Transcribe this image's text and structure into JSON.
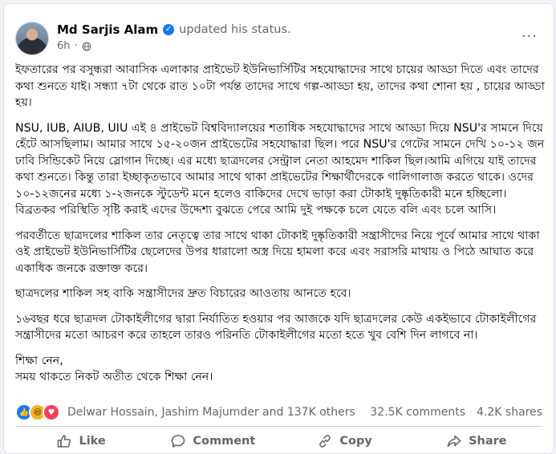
{
  "post": {
    "author": "Md Sarjis Alam",
    "action": "updated his status.",
    "time": "6h",
    "more": "···",
    "paragraphs": [
      "ইফতারের পর বসুন্ধরা আবাসিক এলাকার প্রাইভেট ইউনিভার্সিটির সহযোদ্ধাদের সাথে চায়ের আড্ডা দিতে এবং তাদের কথা শুনতে যাই। সন্ধ্যা ৭টা থেকে রাত ১০টা পর্যন্ত তাদের সাথে গল্প-আড্ডা হয়, তাদের কথা শোনা হয় , চায়ের আড্ডা হয়।",
      "NSU, IUB, AIUB,  UIU এই ৪ প্রাইভেট বিশ্ববিদ্যালয়ের শতাধিক সহযোদ্ধাদের সাথে আড্ডা দিয়ে NSU'র সামনে দিয়ে হেঁটে আসছিলাম। আমার সাথে ১৫-২০জন প্রাইভেটের সহযোদ্ধারা ছিল। পরে NSU'র গেটের সামনে দেখি ১০-১২ জন ঢাবি সিন্ডিকেট নিয়ে স্লোগান দিচ্ছে। এর মধ্যে ছাত্রদলের সেন্ট্রাল নেতা আহমেদ শাকিল ছিল।আমি এগিয়ে যাই তাদের কথা শুনতে। কিন্তু তারা ইচ্ছাকৃতভাবে আমার সাথে থাকা প্রাইভেটের শিক্ষার্থীদেরকে গালিগালাজ করতে থাকে। ওদের ১০-১২জনের মধ্যে ১-২জনকে স্টুডেন্ট মনে হলেও বাকিদের দেখে ভাড়া করা টোকাই দুষ্কৃতিকারী মনে হচ্ছিলো। বিব্রতকর পরিস্থিতি সৃষ্টি করাই এদের উদ্দেশ্য বুঝতে পেরে আমি দুই পক্ষকে চলে যেতে বলি এবং চলে আসি।",
      "পরবর্তীতে ছাত্রদলের শাকিল তার নেতৃত্বে তার সাথে থাকা টোকাই দুষ্কৃতিকারী সন্ত্রাসীদের নিয়ে পূর্বে আমার সাথে থাকা ওই প্রাইভেট ইউনিভার্সিটির ছেলেদের উপর ধারালো অস্ত্র দিয়ে  হামলা করে এবং সরাসরি মাথায় ও পিঠে আঘাত করে একাধিক জনকে রক্তাক্ত করে।",
      "ছাত্রদলের শাকিল সহ বাকি সন্ত্রাসীদের দ্রুত বিচারের আওতায় আনতে হবে।",
      "১৬বছর ধরে ছাত্রদল টোকাইলীগের দ্বারা নির্যাতিত হওয়ার পর আজকে যদি ছাত্রদলের কেউ একইভাবে টোকাইলীগের সন্ত্রাসীদের মতো আচরণ করে তাহলে তারও পরিনতি টোকাইলীগের মতো হতে খুব বেশি দিন লাগবে না।"
    ],
    "closing_line1": "শিক্ষা নেন,",
    "closing_line2": "সময় থাকতে নিকট অতীত থেকে শিক্ষা নেন।"
  },
  "reactions": {
    "icons": [
      "like-reaction-icon",
      "haha-reaction-icon",
      "love-reaction-icon"
    ],
    "names": "Delwar Hossain, Jashim Majumder and 137K others",
    "comments": "32.5K comments",
    "shares": "4.2K shares"
  },
  "actions": {
    "like": "Like",
    "comment": "Comment",
    "copy": "Copy",
    "share": "Share"
  },
  "colors": {
    "accent": "#1877f2",
    "secondary_text": "#65676b",
    "haha": "#f7b125",
    "love": "#f33e58"
  }
}
